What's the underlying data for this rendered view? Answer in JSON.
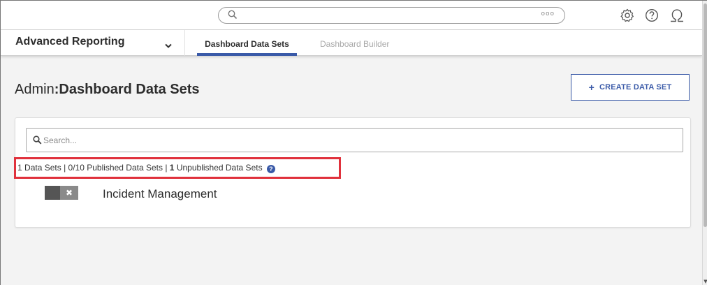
{
  "topbar": {
    "search_dots": "ooo",
    "icons": [
      "search-icon",
      "gear-icon",
      "help-icon",
      "user-icon"
    ]
  },
  "nav": {
    "app_title": "Advanced Reporting",
    "tabs": [
      {
        "label": "Dashboard Data Sets",
        "active": true
      },
      {
        "label": "Dashboard Builder",
        "active": false
      }
    ]
  },
  "page": {
    "title_prefix": "Admin",
    "title_separator": ":",
    "title_section": "Dashboard Data Sets",
    "create_button_label": "CREATE DATA SET",
    "create_button_icon": "+"
  },
  "search": {
    "placeholder": "Search..."
  },
  "stats": {
    "data_sets_count": "1",
    "data_sets_label": "Data Sets",
    "divider": "|",
    "published_count": "0/10",
    "published_label": "Published Data Sets",
    "unpublished_count": "1",
    "unpublished_label": "Unpublished Data Sets"
  },
  "items": [
    {
      "name": "Incident Management",
      "published": false,
      "toggle_off_glyph": "✖"
    }
  ],
  "colors": {
    "accent": "#3a5aa8",
    "highlight": "#e0313c",
    "background": "#f3f3f3"
  }
}
